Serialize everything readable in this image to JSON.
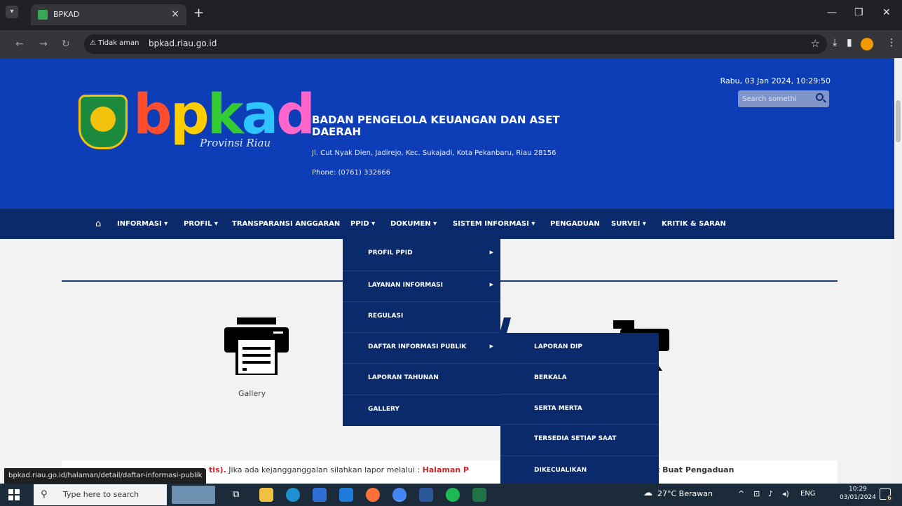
{
  "browser": {
    "tab_title": "BPKAD",
    "tab_close": "×",
    "new_tab": "+",
    "security_label": "⚠ Tidak aman",
    "url": "bpkad.riau.go.id",
    "status_url": "bpkad.riau.go.id/halaman/detail/daftar-informasi-publik"
  },
  "header": {
    "logo_letters": [
      "b",
      "p",
      "k",
      "a",
      "d"
    ],
    "logo_subtitle": "Provinsi Riau",
    "org_name": "BADAN PENGELOLA KEUANGAN DAN ASET DAERAH",
    "address": "Jl. Cut Nyak Dien, Jadirejo, Kec. Sukajadi, Kota Pekanbaru, Riau 28156",
    "phone": "Phone: (0761) 332666",
    "datetime": "Rabu, 03 Jan 2024, 10:29:50",
    "search_placeholder": "Search somethi"
  },
  "nav": {
    "items": [
      "INFORMASI ▾",
      "PROFIL ▾",
      "TRANSPARANSI ANGGARAN",
      "PPID ▾",
      "DOKUMEN ▾",
      "SISTEM INFORMASI ▾",
      "PENGADUAN",
      "SURVEI ▾",
      "KRITIK & SARAN"
    ]
  },
  "ppid_menu": {
    "items": [
      "PROFIL PPID",
      "LAYANAN INFORMASI",
      "REGULASI",
      "DAFTAR INFORMASI PUBLIK",
      "LAPORAN TAHUNAN",
      "GALLERY"
    ]
  },
  "dip_menu": {
    "items": [
      "LAPORAN DIP",
      "BERKALA",
      "SERTA MERTA",
      "TERSEDIA SETIAP SAAT",
      "DIKECUALIKAN"
    ]
  },
  "content": {
    "gallery_label": "Gallery",
    "notice_bold": "tis).",
    "notice_text": " Jika ada kejangganggalan silahkan lapor melalui : ",
    "notice_link": "Halaman P",
    "notice_link2": "t Buat Pengaduan"
  },
  "taskbar": {
    "search_text": "Type here to search",
    "weather": "27°C Berawan",
    "lang": "ENG",
    "time": "10:29",
    "date": "03/01/2024",
    "notif_count": "6"
  },
  "colors": {
    "header_blue": "#0d3eb8",
    "nav_navy": "#0b2a6b",
    "accent_red": "#c62828"
  }
}
